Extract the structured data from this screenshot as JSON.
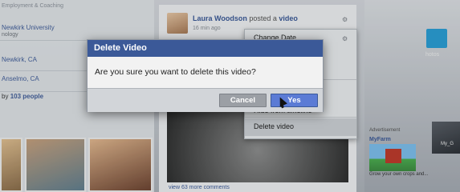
{
  "left_column": {
    "header": "Employment & Coaching",
    "info": [
      {
        "text": "Newkirk University",
        "sub": "nology"
      },
      {
        "text": "Newkirk, CA",
        "sub": ""
      },
      {
        "text": "Anselmo, CA",
        "sub": ""
      }
    ],
    "friends": {
      "prefix": "by",
      "link": "103 people"
    }
  },
  "post": {
    "author": "Laura Woodson",
    "action": "posted a",
    "object": "video",
    "time": "16 min ago",
    "more_comments": "view 63 more comments"
  },
  "menu": {
    "items": [
      "Change Date",
      "Hide from timeline",
      "Delete video"
    ],
    "selected": "Delete video"
  },
  "sidebar": {
    "ad_label": "Advertisement",
    "ad_title": "MyFarm",
    "ad_text": "Grow your own crops and..."
  },
  "desktop": {
    "icon_label": "hotos",
    "thumb_label": "My_G"
  },
  "dialog": {
    "title": "Delete Video",
    "message": "Are you sure you want to delete this video?",
    "cancel_label": "Cancel",
    "confirm_label": "Yes"
  },
  "colors": {
    "brand": "#3b5998",
    "confirm_button": "#5b7bd5",
    "cancel_button": "#9b9fa5"
  },
  "icons": [
    "gear-icon",
    "mouse-cursor-icon"
  ]
}
